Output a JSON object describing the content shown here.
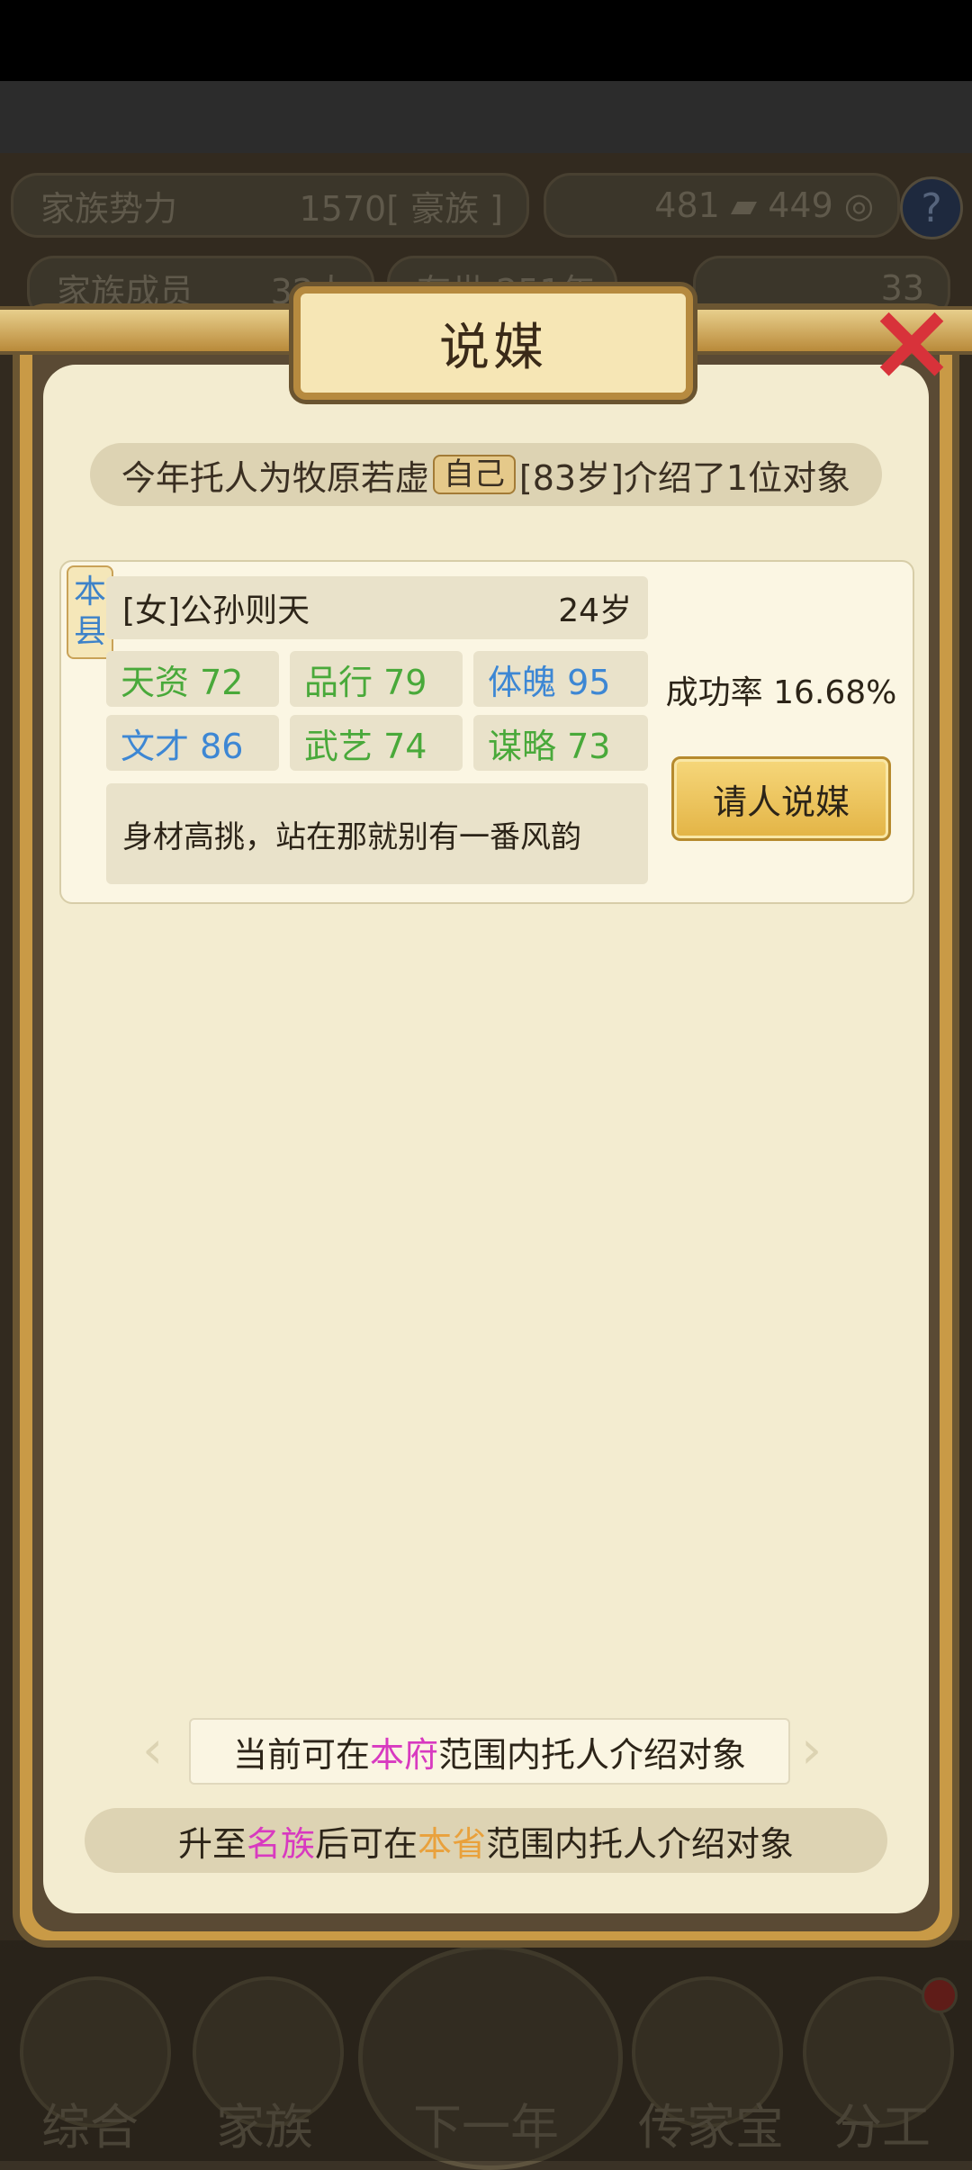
{
  "background_hud": {
    "power_label": "家族势力",
    "power_value": "1570",
    "power_rank": "[ 豪族 ]",
    "currency_a": "481",
    "currency_b": "449",
    "members_label": "家族成员",
    "members_value": "32人",
    "years_value": "存世 251年",
    "gold_value": "33"
  },
  "dialog": {
    "title": "说媒",
    "info": {
      "prefix": "今年托人为牧原若虚",
      "self_tag": "自己",
      "suffix": "[83岁]介绍了1位对象"
    },
    "candidate": {
      "region_tag": "本县",
      "name": "[女]公孙则天",
      "age": "24岁",
      "stats": [
        {
          "label": "天资 72",
          "color": "green"
        },
        {
          "label": "品行 79",
          "color": "green"
        },
        {
          "label": "体魄 95",
          "color": "blue"
        },
        {
          "label": "文才 86",
          "color": "blue"
        },
        {
          "label": "武艺 74",
          "color": "green"
        },
        {
          "label": "谋略 73",
          "color": "green"
        }
      ],
      "description": "身材高挑，站在那就别有一番风韵",
      "success_rate": "成功率 16.68%",
      "action_label": "请人说媒"
    },
    "scope": {
      "prefix": "当前可在",
      "highlight": "本府",
      "suffix": "范围内托人介绍对象"
    },
    "upgrade": {
      "p1": "升至",
      "h1": "名族",
      "p2": "后可在",
      "h2": "本省",
      "p3": "范围内托人介绍对象"
    }
  },
  "bottom_nav": {
    "items": [
      "综合",
      "家族",
      "下一年",
      "传家宝",
      "分工"
    ]
  },
  "colors": {
    "green_stat": "#49a93a",
    "blue_stat": "#3d87d4",
    "highlight_pink": "#d83ac0",
    "highlight_orange": "#e9a13c",
    "action_gold": "#e3b445"
  }
}
